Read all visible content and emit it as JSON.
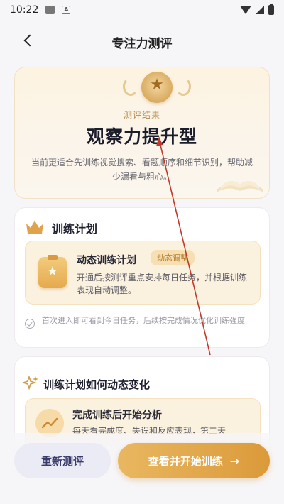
{
  "status_bar": {
    "time": "10:22"
  },
  "header": {
    "title": "专注力测评"
  },
  "result": {
    "label": "测评结果",
    "type": "观察力提升型",
    "description": "当前更适合先训练视觉搜索、看题顺序和细节识别，帮助减少漏看与粗心。"
  },
  "plan": {
    "title": "训练计划",
    "item_title": "动态训练计划",
    "item_badge": "动态调整",
    "item_desc": "开通后按测评重点安排每日任务，并根据训练表现自动调整。",
    "note": "首次进入即可看到今日任务，后续按完成情况优化训练强度"
  },
  "dynamic": {
    "title": "训练计划如何动态变化",
    "step_title": "完成训练后开始分析",
    "step_desc": "每天看完成度、失误和反应表现，第二天"
  },
  "actions": {
    "retest_label": "重新测评",
    "start_label": "查看并开始训练"
  },
  "colors": {
    "accent": "#db9a3a",
    "card_bg": "#fbf1df",
    "retest_bg": "#ebebf5",
    "annotation": "#c0392b"
  }
}
